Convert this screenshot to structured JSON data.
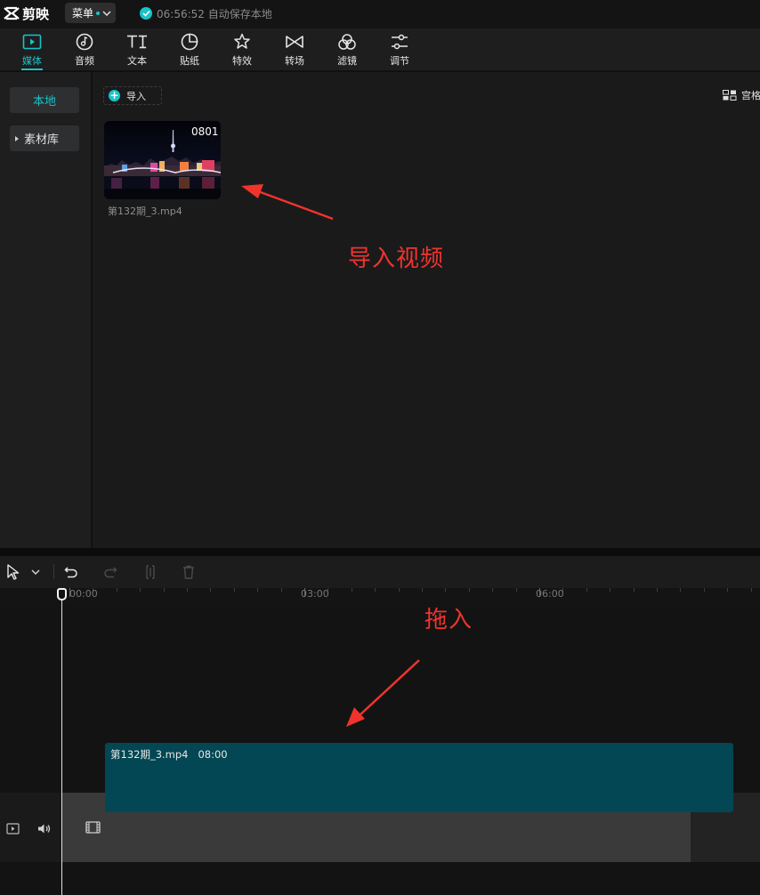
{
  "app": {
    "name": "剪映",
    "menu_label": "菜单",
    "autosave_text": "06:56:52 自动保存本地"
  },
  "toolbar": {
    "active_tab": "媒体",
    "tabs": [
      {
        "label": "媒体",
        "icon": "media-icon"
      },
      {
        "label": "音频",
        "icon": "audio-icon"
      },
      {
        "label": "文本",
        "icon": "text-icon"
      },
      {
        "label": "贴纸",
        "icon": "sticker-icon"
      },
      {
        "label": "特效",
        "icon": "effects-icon"
      },
      {
        "label": "转场",
        "icon": "transition-icon"
      },
      {
        "label": "滤镜",
        "icon": "filter-icon"
      },
      {
        "label": "调节",
        "icon": "adjust-icon"
      }
    ]
  },
  "sidebar": {
    "items": [
      {
        "label": "本地",
        "active": true
      },
      {
        "label": "素材库",
        "active": false
      }
    ]
  },
  "media": {
    "import_label": "导入",
    "view_toggle_label": "宫格",
    "clip": {
      "duration": "0801",
      "filename": "第132期_3.mp4"
    }
  },
  "annotations": {
    "import_video": "导入视频",
    "drag_in": "拖入"
  },
  "timeline": {
    "ruler_labels": [
      "00:00",
      "03:00",
      "06:00"
    ],
    "clip_name": "第132期_3.mp4",
    "clip_duration": "08:00"
  },
  "colors": {
    "accent": "#19c3c9",
    "annotation_red": "#f0342c",
    "clip_teal": "#024753"
  }
}
